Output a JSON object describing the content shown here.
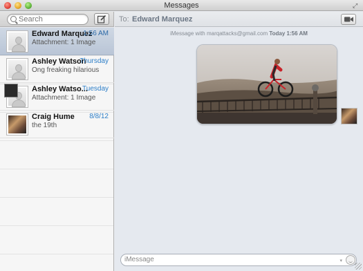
{
  "window": {
    "title": "Messages"
  },
  "toolbar": {
    "search_placeholder": "Search"
  },
  "conversation_header": {
    "to_label": "To:",
    "recipient": "Edward Marquez"
  },
  "conversations": [
    {
      "name": "Edward Marquez",
      "time": "1:56 AM",
      "preview": "Attachment: 1 Image",
      "selected": true,
      "avatar": "placeholder"
    },
    {
      "name": "Ashley Watson",
      "time": "Thursday",
      "preview": "Ong freaking hilarious",
      "selected": false,
      "avatar": "placeholder"
    },
    {
      "name": "Ashley Watso...",
      "time": "Tuesday",
      "preview": "Attachment: 1 Image",
      "selected": false,
      "avatar": "group"
    },
    {
      "name": "Craig Hume",
      "time": "8/8/12",
      "preview": "the 19th",
      "selected": false,
      "avatar": "photo"
    }
  ],
  "message_meta": {
    "prefix": "iMessage with marqattacks@gmail.com",
    "time": "Today 1:56 AM"
  },
  "image_message": {
    "alt_icon": "photo-cyclist"
  },
  "composer": {
    "placeholder": "iMessage"
  },
  "colors": {
    "accent_time": "#2d7ec7",
    "selection": "#c4ceda",
    "pane_bg": "#e5e9ef"
  }
}
